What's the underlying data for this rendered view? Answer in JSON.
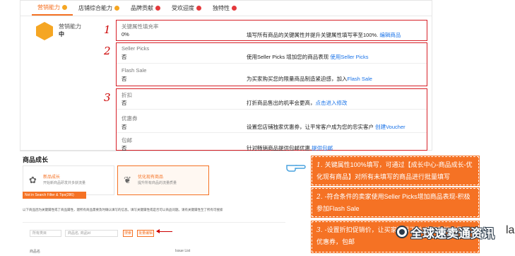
{
  "tabs": [
    {
      "label": "营销能力",
      "status": "orange",
      "active": true
    },
    {
      "label": "店铺综合能力",
      "status": "orange",
      "active": false
    },
    {
      "label": "品牌贡献",
      "status": "red",
      "active": false
    },
    {
      "label": "受欢迎度",
      "status": "red",
      "active": false
    },
    {
      "label": "独特性",
      "status": "red",
      "active": false
    }
  ],
  "capability": {
    "title": "营销能力",
    "value": "中"
  },
  "annotations_numbers": [
    "1",
    "2",
    "3"
  ],
  "rows": {
    "key_attr": {
      "label": "关键属性填充率",
      "value": "0%",
      "desc": "填写所有商品的关键属性并提升关键属性填写率至100%.",
      "link": "编辑商品"
    },
    "seller_picks": {
      "label": "Seller Picks",
      "value": "否",
      "desc": "使用Seller Picks 增加您的商品表现",
      "link": "使用Seller Picks"
    },
    "flash_sale": {
      "label": "Flash Sale",
      "value": "否",
      "desc": "为买家购买您的限量商品制造紧迫感，加入",
      "link": "Flash Sale"
    },
    "discount": {
      "label": "折扣",
      "value": "否",
      "desc": "打折商品售出的机率会更高，",
      "link": "点击进入修改"
    },
    "voucher": {
      "label": "优惠券",
      "value": "否",
      "desc": "设置您店铺独家优惠券，让平常客户成为您的忠实客户",
      "link": "创建Voucher"
    },
    "free_shipping": {
      "label": "包邮",
      "value": "否",
      "desc": "针对畅销商品提供包邮优惠,",
      "link": "提供包邮"
    }
  },
  "bottom": {
    "title": "商品成长",
    "card1_title": "新品成长",
    "card1_sub": "开始新商品研发并多获流量",
    "card2_title": "优化现有商品",
    "card2_sub": "提升所有商品的流量质量",
    "tag": "Not in Search Filter & Tips(286)",
    "desc": "以下商品因为关键属性或了商品属性，建所有商品需要及时确认填写的信息。填写关键属性或是否可以商品问题。请有关键属性至了所有可搜索",
    "select_placeholder": "所有类目",
    "search_placeholder": "商品名, 商品Id",
    "filter_btn": "搜索",
    "batch_btn": "批量编辑",
    "col1": "商品名",
    "col2": "Issue List"
  },
  "callouts": [
    {
      "num": "1.",
      "text": "关键属性100%填写，可通过【成长中心-商品成长-优化现有商品】对所有未填写的商品进行批量填写"
    },
    {
      "num": "2.",
      "text": "-符合条件的卖家使用Seller Picks增加商品表现-积极参加Flash Sale"
    },
    {
      "num": "3.",
      "text": "-设置折扣促销价，让买家更易下单-使用营销工具，优惠券，包邮"
    }
  ],
  "watermark": "全球速卖通资讯",
  "side_note": "la",
  "colors": {
    "accent": "#f57224",
    "highlight": "#d71f27",
    "link": "#1a73e8"
  }
}
